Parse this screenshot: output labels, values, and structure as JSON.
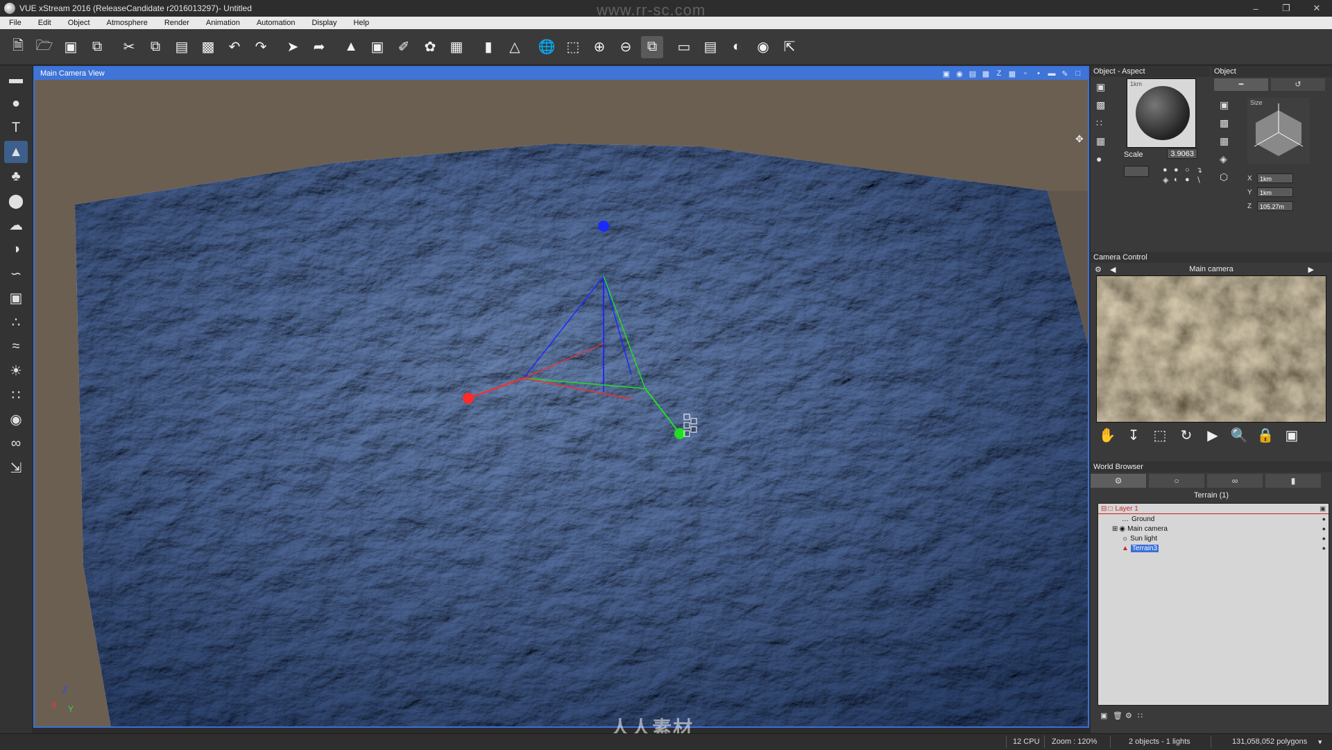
{
  "window": {
    "title": "VUE xStream 2016 (ReleaseCandidate r2016013297)- Untitled",
    "watermark_url": "www.rr-sc.com",
    "controls": [
      "minimize-icon",
      "restore-icon",
      "close-icon"
    ]
  },
  "menu": [
    "File",
    "Edit",
    "Object",
    "Atmosphere",
    "Render",
    "Animation",
    "Automation",
    "Display",
    "Help"
  ],
  "toolbar_icons": [
    "new-file-icon",
    "open-file-icon",
    "save-icon",
    "save-as-icon",
    "cut-icon",
    "copy-icon",
    "paste-icon",
    "duplicate-icon",
    "undo-icon",
    "redo-icon",
    "select-icon",
    "select-by-icon",
    "terrain-editor-icon",
    "object-aspect-icon",
    "material-icon",
    "atmosphere-icon",
    "animation-icon",
    "align-icon",
    "mirror-icon",
    "world-icon",
    "fit-view-icon",
    "zoom-in-icon",
    "zoom-out-icon",
    "view-mode-icon",
    "render-frame-icon",
    "safe-frame-icon",
    "wireframe-icon",
    "snapshot-icon",
    "export-icon"
  ],
  "left_tools": [
    "plane-icon",
    "sphere-icon",
    "text-icon",
    "terrain-icon",
    "plant-icon",
    "rock-icon",
    "cloud-icon",
    "planet-icon",
    "path-icon",
    "cube-icon",
    "ecosystem-icon",
    "tornado-icon",
    "light-icon",
    "metablob-icon",
    "boolean-icon",
    "link-icon",
    "import-icon"
  ],
  "viewport": {
    "title": "Main Camera View",
    "header_icons": [
      "view-icon-1",
      "view-icon-2",
      "view-icon-3",
      "view-icon-4",
      "z-icon",
      "view-icon-5",
      "view-icon-6",
      "view-icon-7",
      "view-icon-8",
      "pencil-icon",
      "maximize-icon"
    ],
    "watermark": "人人素材",
    "axis_labels": {
      "z": "Z",
      "x": "X",
      "y": "Y"
    }
  },
  "aspect_panel": {
    "title": "Object - Aspect",
    "scale_label": "Scale",
    "scale_value": "3.9063",
    "unit_label": "1km"
  },
  "object_panel": {
    "title": "Object",
    "size_label": "Size",
    "x_label": "X",
    "y_label": "Y",
    "z_label": "Z",
    "x_value": "1km",
    "y_value": "1km",
    "z_value": "105.27m"
  },
  "camera_control": {
    "title": "Camera Control",
    "camera_name": "Main camera",
    "icons": [
      "hand-pan-icon",
      "move-down-icon",
      "frame-select-icon",
      "rotate-icon",
      "play-icon",
      "zoom-camera-icon",
      "lock-icon",
      "camera-snapshot-icon"
    ]
  },
  "world_browser": {
    "title": "World Browser",
    "tabs": [
      "objects-tab-icon",
      "materials-tab-icon",
      "links-tab-icon",
      "stats-tab-icon"
    ],
    "caption": "Terrain (1)",
    "tree": [
      {
        "label": "Layer 1",
        "kind": "layer"
      },
      {
        "label": "Ground",
        "kind": "item"
      },
      {
        "label": "Main camera",
        "kind": "item"
      },
      {
        "label": "Sun light",
        "kind": "item"
      },
      {
        "label": "Terrain3",
        "kind": "selected"
      }
    ]
  },
  "status": {
    "cpu": "12 CPU",
    "zoom": "Zoom : 120%",
    "objects": "2 objects - 1 lights",
    "polygons": "131,058,052 polygons"
  },
  "colors": {
    "accent": "#3f74d8",
    "gizmo_x": "#ff2a2a",
    "gizmo_y": "#22dd22",
    "gizmo_z": "#1a2aff"
  }
}
